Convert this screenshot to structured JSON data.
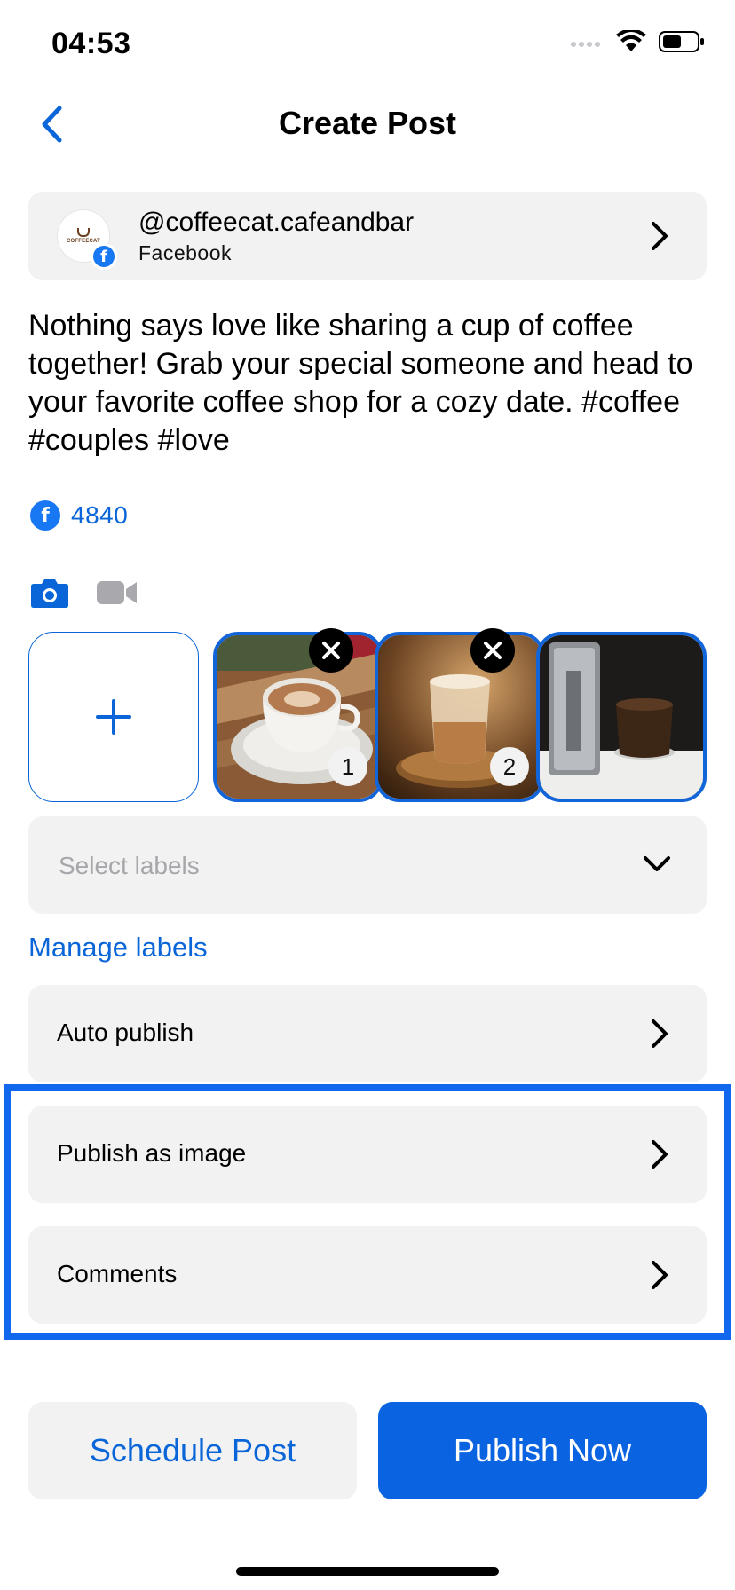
{
  "status_bar": {
    "time": "04:53"
  },
  "nav": {
    "title": "Create Post"
  },
  "account": {
    "handle": "@coffeecat.cafeandbar",
    "platform": "Facebook",
    "avatar_text": "COFFEECAT"
  },
  "post": {
    "text": "Nothing says love like sharing a cup of coffee together! Grab your special someone and head to your favorite coffee shop for a cozy date. #coffee #couples #love"
  },
  "reach": {
    "count": "4840"
  },
  "media": {
    "items": [
      {
        "index": "1",
        "subject": "latte-art-cup"
      },
      {
        "index": "2",
        "subject": "iced-coffee-glass"
      },
      {
        "index": "",
        "subject": "aeropress"
      }
    ]
  },
  "labels": {
    "placeholder": "Select labels",
    "manage_link": "Manage labels"
  },
  "options": [
    {
      "label": "Auto publish"
    },
    {
      "label": "Publish as image"
    },
    {
      "label": "Comments"
    }
  ],
  "actions": {
    "schedule_label": "Schedule Post",
    "publish_label": "Publish Now"
  },
  "colors": {
    "accent": "#0a66d8",
    "highlight": "#1167ee",
    "facebook": "#1877f2",
    "card_bg": "#f2f2f3"
  },
  "icons": [
    "signal-icon",
    "wifi-icon",
    "battery-icon",
    "back-chevron-icon",
    "chevron-right-icon",
    "facebook-icon",
    "camera-icon",
    "video-icon",
    "plus-icon",
    "close-icon",
    "chevron-down-icon"
  ]
}
